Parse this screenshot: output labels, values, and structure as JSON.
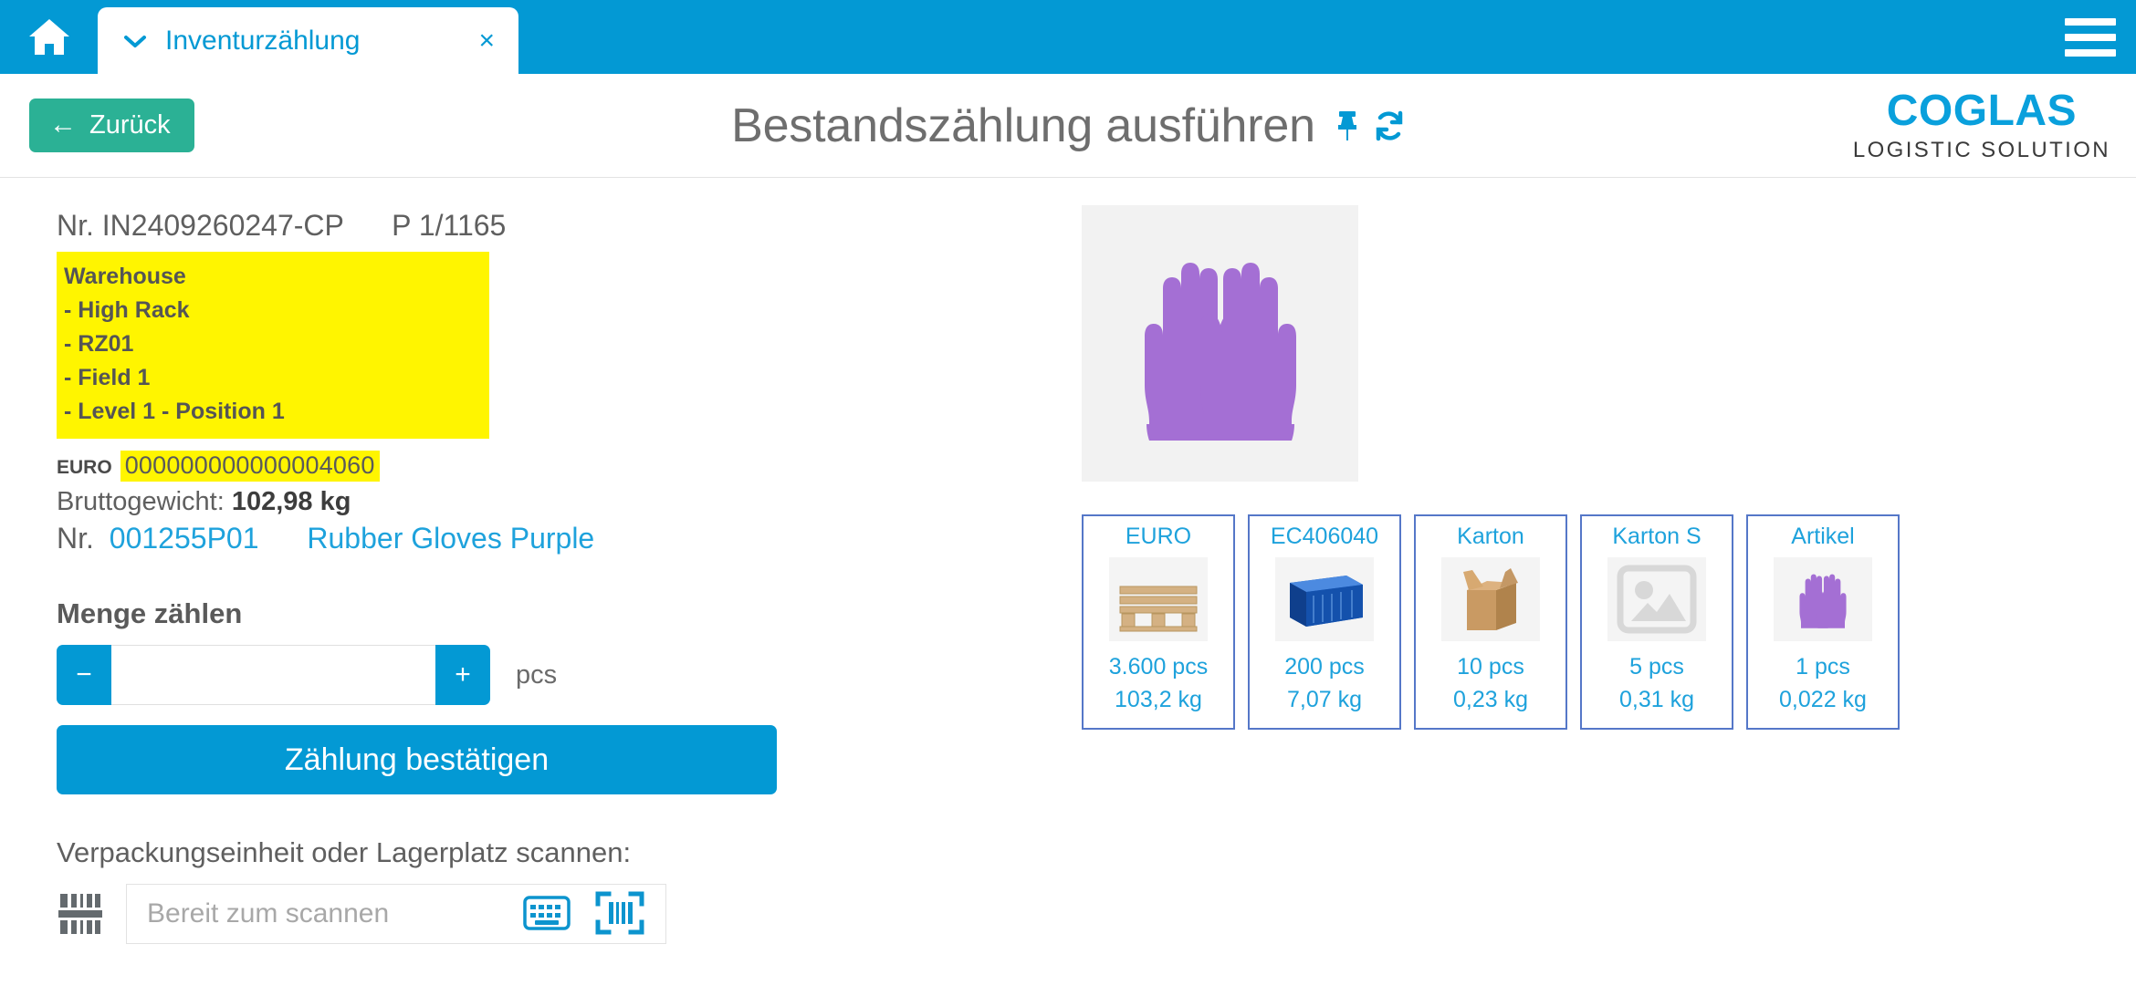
{
  "tabbar": {
    "home_icon": "home-icon",
    "tab_title": "Inventurzählung",
    "tab_close": "×",
    "menu_icon": "hamburger-menu-icon"
  },
  "header": {
    "back_label": "Zurück",
    "back_arrow": "←",
    "page_title": "Bestandszählung ausführen",
    "pin_icon": "pin-icon",
    "refresh_icon": "refresh-icon",
    "brand_main": "COGLAS",
    "brand_sub": "LOGISTIC SOLUTION",
    "accent_blue": "#0399D4",
    "back_green": "#2BB195",
    "brand_blue": "#0AA0DC"
  },
  "info": {
    "nr_prefix": "Nr.",
    "document_no": "IN2409260247-CP",
    "page_indicator": "P 1/1165",
    "location_lines": [
      "Warehouse",
      "- High Rack",
      "- RZ01",
      "- Field 1",
      "- Level 1 - Position 1"
    ],
    "highlight_color": "#FFF500",
    "euro_label": "EURO",
    "euro_code": "000000000000004060",
    "gross_weight_label": "Bruttogewicht:",
    "gross_weight_value": "102,98 kg",
    "article_nr_prefix": "Nr.",
    "article_no": "001255P01",
    "article_name": "Rubber Gloves Purple"
  },
  "quantity": {
    "heading": "Menge zählen",
    "minus_label": "−",
    "plus_label": "+",
    "value": "",
    "placeholder": "",
    "unit": "pcs",
    "confirm_label": "Zählung bestätigen"
  },
  "scan": {
    "label": "Verpackungseinheit oder Lagerplatz scannen:",
    "barcode_icon": "barcode-icon",
    "placeholder": "Bereit zum scannen",
    "value": "",
    "keyboard_icon": "keyboard-icon",
    "scan_icon": "barcode-scan-icon"
  },
  "product": {
    "image_alt": "purple-rubber-gloves-image"
  },
  "packaging_units": [
    {
      "name": "EURO",
      "icon": "euro-pallet-image",
      "qty": "3.600 pcs",
      "weight": "103,2 kg"
    },
    {
      "name": "EC406040",
      "icon": "blue-crate-image",
      "qty": "200 pcs",
      "weight": "7,07 kg"
    },
    {
      "name": "Karton",
      "icon": "cardboard-box-image",
      "qty": "10 pcs",
      "weight": "0,23 kg"
    },
    {
      "name": "Karton S",
      "icon": "image-placeholder-icon",
      "qty": "5 pcs",
      "weight": "0,31 kg"
    },
    {
      "name": "Artikel",
      "icon": "purple-gloves-image",
      "qty": "1 pcs",
      "weight": "0,022 kg"
    }
  ]
}
